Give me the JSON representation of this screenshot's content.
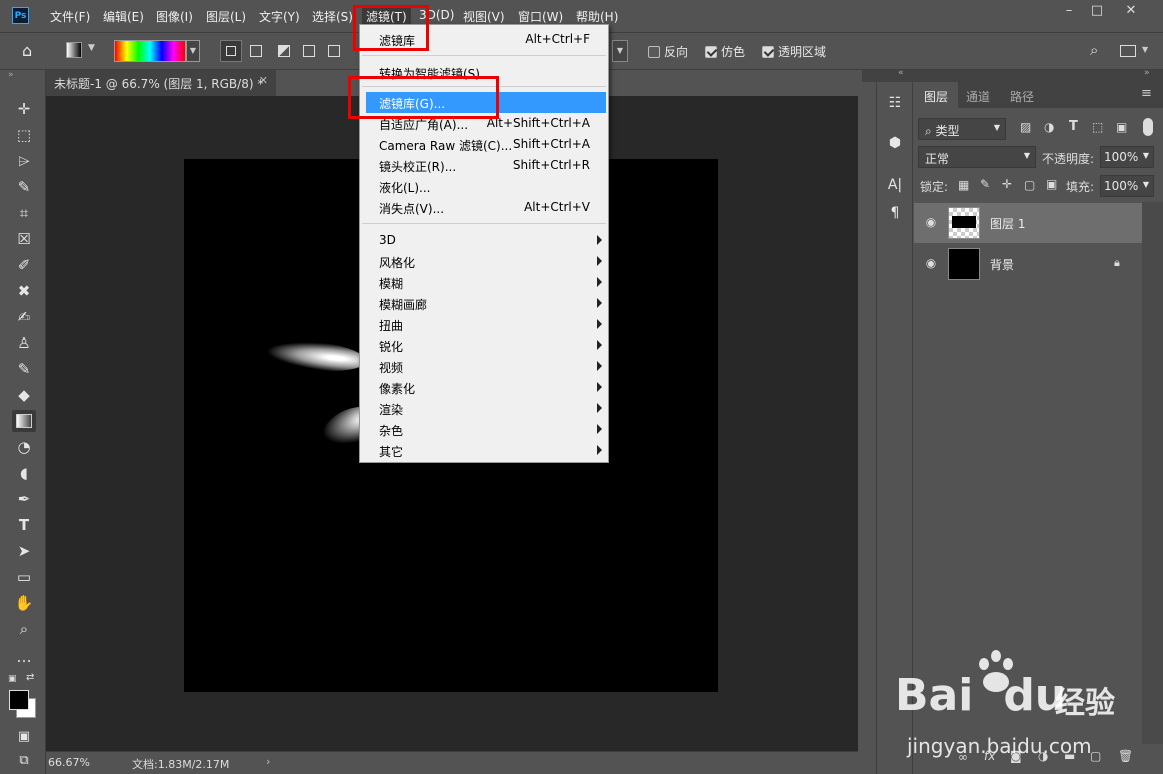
{
  "app": {
    "logo": "Ps"
  },
  "menubar": {
    "items": [
      "文件(F)",
      "编辑(E)",
      "图像(I)",
      "图层(L)",
      "文字(Y)",
      "选择(S)",
      "滤镜(T)",
      "3D(D)",
      "视图(V)",
      "窗口(W)",
      "帮助(H)"
    ],
    "active": "滤镜(T)",
    "window_controls": [
      "minimize-icon",
      "restore-icon",
      "close-icon"
    ]
  },
  "options": {
    "reverse": {
      "label": "反向",
      "checked": false
    },
    "dither": {
      "label": "仿色",
      "checked": true
    },
    "transparency": {
      "label": "透明区域",
      "checked": true
    }
  },
  "document": {
    "tab_title": "未标题-1 @ 66.7% (图层 1, RGB/8) *",
    "zoom": "66.67%",
    "doc_size": "文档:1.83M/2.17M"
  },
  "filter_menu": {
    "items": [
      {
        "label": "滤镜库",
        "shortcut": "Alt+Ctrl+F"
      },
      {
        "label": "转换为智能滤镜(S)"
      },
      {
        "label": "滤镜库(G)...",
        "highlighted": true
      },
      {
        "label": "自适应广角(A)...",
        "shortcut": "Alt+Shift+Ctrl+A"
      },
      {
        "label": "Camera Raw 滤镜(C)...",
        "shortcut": "Shift+Ctrl+A"
      },
      {
        "label": "镜头校正(R)...",
        "shortcut": "Shift+Ctrl+R"
      },
      {
        "label": "液化(L)..."
      },
      {
        "label": "消失点(V)...",
        "shortcut": "Alt+Ctrl+V"
      },
      {
        "label": "3D",
        "submenu": true
      },
      {
        "label": "风格化",
        "submenu": true
      },
      {
        "label": "模糊",
        "submenu": true
      },
      {
        "label": "模糊画廊",
        "submenu": true
      },
      {
        "label": "扭曲",
        "submenu": true
      },
      {
        "label": "锐化",
        "submenu": true
      },
      {
        "label": "视频",
        "submenu": true
      },
      {
        "label": "像素化",
        "submenu": true
      },
      {
        "label": "渲染",
        "submenu": true
      },
      {
        "label": "杂色",
        "submenu": true
      },
      {
        "label": "其它",
        "submenu": true
      }
    ]
  },
  "layers_panel": {
    "tabs": [
      "图层",
      "通道",
      "路径"
    ],
    "filter_type": "类型",
    "blend_mode": "正常",
    "opacity_label": "不透明度:",
    "opacity": "100%",
    "lock_label": "锁定:",
    "fill_label": "填充:",
    "fill": "100%",
    "layers": [
      {
        "name": "图层 1",
        "selected": true
      },
      {
        "name": "背景",
        "locked": true
      }
    ]
  },
  "watermark": {
    "brand_a": "Bai",
    "brand_b": "du",
    "brand_c": "经验",
    "url": "jingyan.baidu.com"
  },
  "colors": {
    "menu_highlight": "#3399ff",
    "red_box": "#ee0000",
    "panel": "#535353",
    "workspace": "#282828"
  }
}
